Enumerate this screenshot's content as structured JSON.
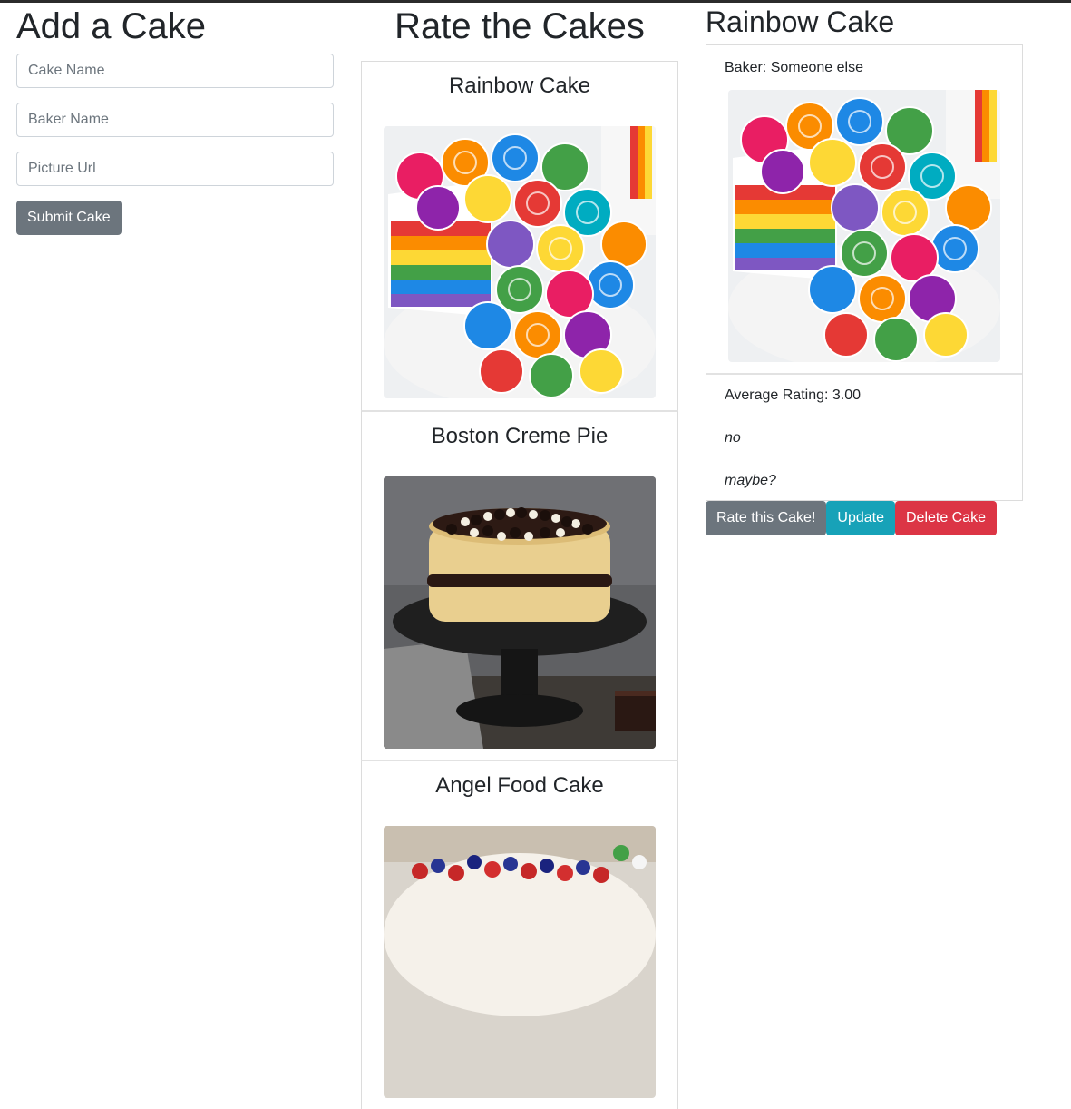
{
  "add_form": {
    "heading": "Add a Cake",
    "cake_name_placeholder": "Cake Name",
    "baker_name_placeholder": "Baker Name",
    "picture_url_placeholder": "Picture Url",
    "submit_label": "Submit Cake"
  },
  "rate_section": {
    "heading": "Rate the Cakes",
    "cakes": [
      {
        "name": "Rainbow Cake"
      },
      {
        "name": "Boston Creme Pie"
      },
      {
        "name": "Angel Food Cake"
      }
    ]
  },
  "detail": {
    "title": "Rainbow Cake",
    "baker": "Baker: Someone else",
    "average_rating": "Average Rating: 3.00",
    "reviews": [
      "no",
      "maybe?"
    ],
    "rate_label": "Rate this Cake!",
    "update_label": "Update",
    "delete_label": "Delete Cake"
  },
  "colors": {
    "secondary": "#6c757d",
    "info": "#17a2b8",
    "danger": "#dc3545",
    "text": "#212529"
  }
}
